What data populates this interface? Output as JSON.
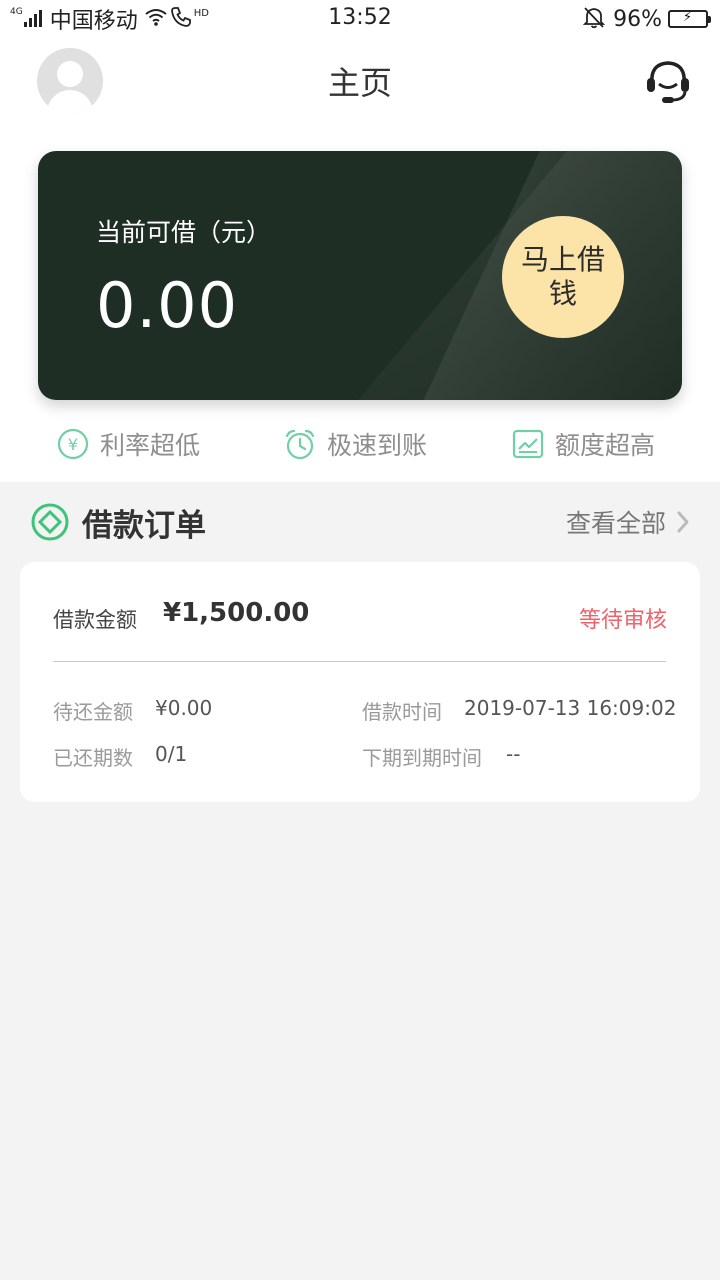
{
  "status_bar": {
    "network": "4G",
    "carrier": "中国移动",
    "hd": "HD",
    "time": "13:52",
    "battery": "96%",
    "battery_level": 0.96
  },
  "header": {
    "title": "主页"
  },
  "card": {
    "label": "当前可借（元）",
    "amount": "0.00",
    "borrow_button": "马上借钱"
  },
  "features": [
    {
      "label": "利率超低",
      "icon": "yen-icon"
    },
    {
      "label": "极速到账",
      "icon": "alarm-clock-icon"
    },
    {
      "label": "额度超高",
      "icon": "chart-icon"
    }
  ],
  "orders": {
    "title": "借款订单",
    "view_all": "查看全部",
    "item": {
      "amount_label": "借款金额",
      "amount": "¥1,500.00",
      "status": "等待审核",
      "pending_label": "待还金额",
      "pending_value": "¥0.00",
      "time_label": "借款时间",
      "time_value": "2019-07-13 16:09:02",
      "periods_label": "已还期数",
      "periods_value": "0/1",
      "next_due_label": "下期到期时间",
      "next_due_value": "--"
    }
  },
  "colors": {
    "card_bg": "#1f2e24",
    "button_bg": "#fce4a9",
    "accent_green": "#3ec47a",
    "status_red": "#f0626a",
    "feature_icon": "#6fd0a4"
  }
}
